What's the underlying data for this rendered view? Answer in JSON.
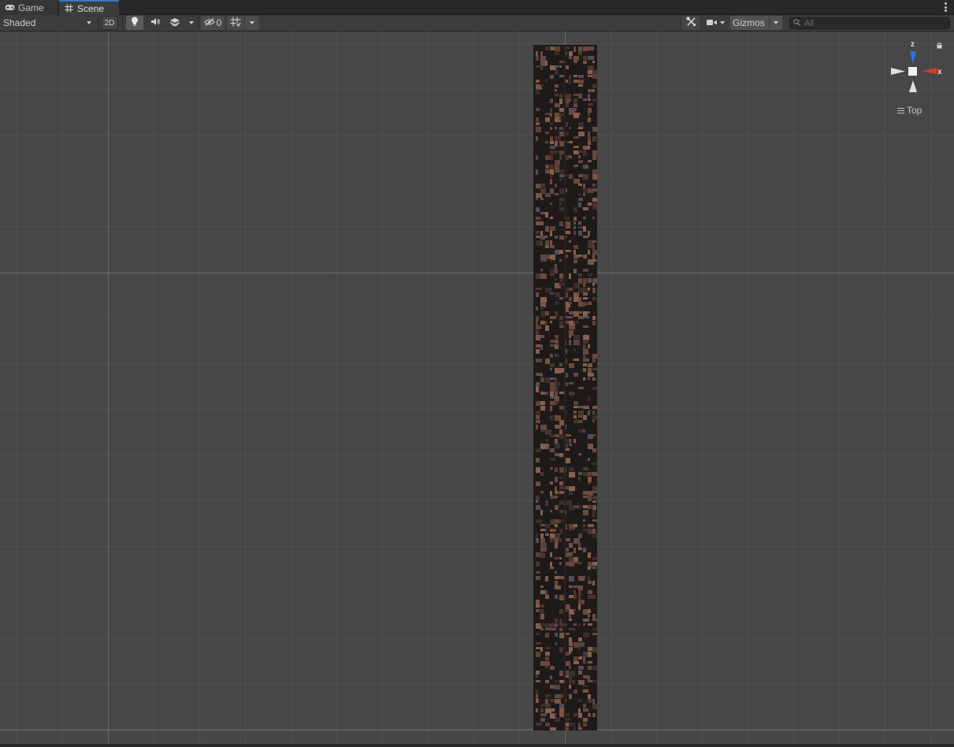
{
  "tabs": [
    {
      "label": "Game",
      "icon": "gamepad-icon",
      "active": false
    },
    {
      "label": "Scene",
      "icon": "hash-icon",
      "active": true
    }
  ],
  "toolbar": {
    "draw_mode": "Shaded",
    "mode_2d": "2D",
    "hidden_count": "0",
    "gizmos_label": "Gizmos",
    "search_placeholder": "All"
  },
  "viewport": {
    "orientation_axes": {
      "z": "z",
      "x": "x"
    },
    "view_name": "Top",
    "axis_colors": {
      "z": "#2f6fe4",
      "x": "#e33b22",
      "center": "#f2f2f2"
    }
  },
  "colors": {
    "accent": "#3a79bb",
    "viewport_bg": "#474747",
    "tile_dark": "#1e1a19",
    "tile_brown": "#6b4a3e"
  }
}
